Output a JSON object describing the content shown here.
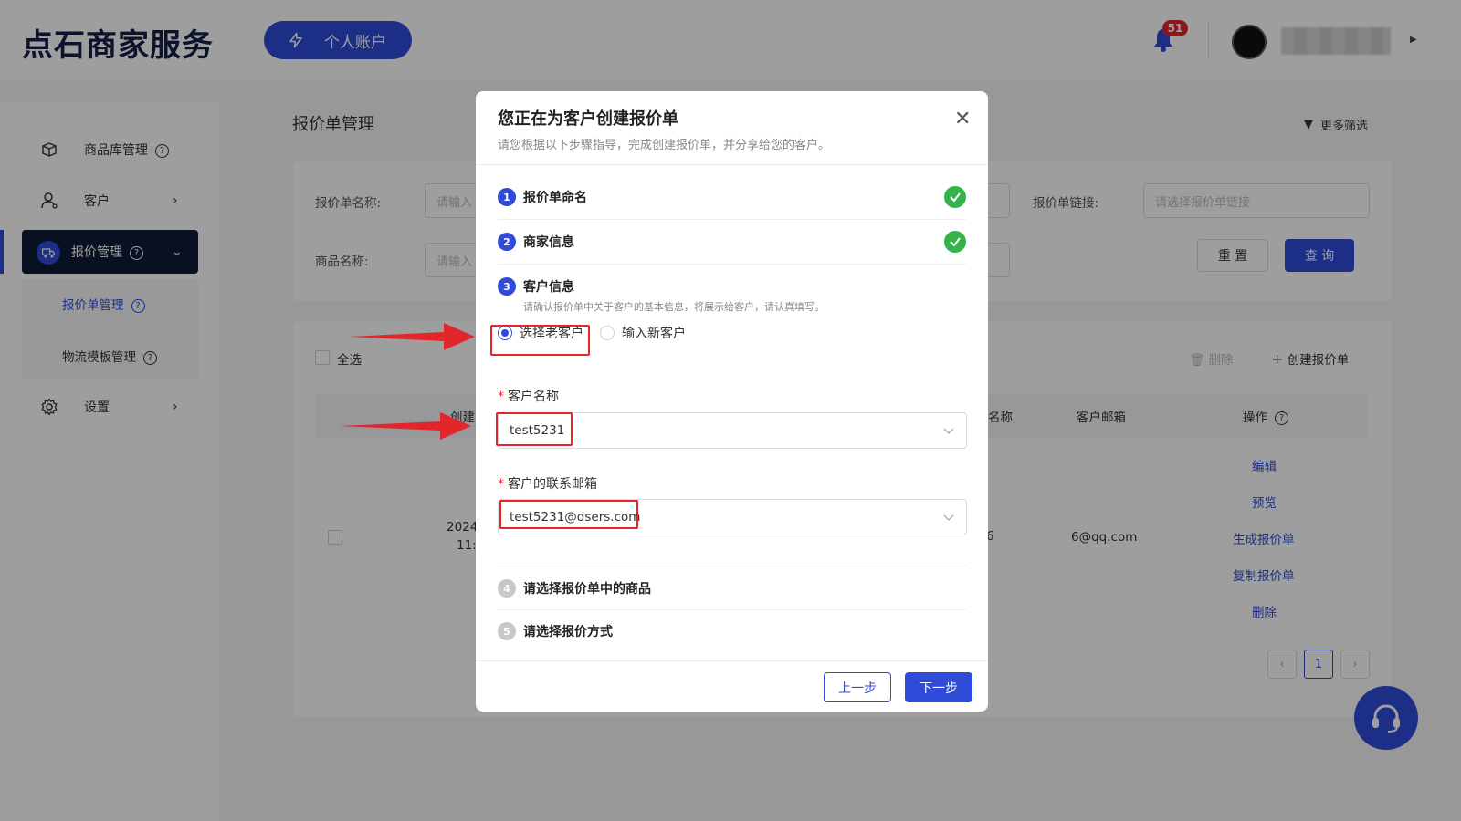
{
  "header": {
    "logo": "点石商家服务",
    "account_button": "个人账户",
    "notification_count": "51"
  },
  "sidebar": {
    "items": [
      {
        "label": "商品库管理"
      },
      {
        "label": "客户"
      },
      {
        "label": "报价管理"
      },
      {
        "label": "设置"
      }
    ],
    "sub_items": [
      {
        "label": "报价单管理"
      },
      {
        "label": "物流模板管理"
      }
    ]
  },
  "main": {
    "title": "报价单管理",
    "more_filter": "更多筛选",
    "filters": {
      "quote_name_label": "报价单名称:",
      "quote_name_placeholder": "请输入",
      "product_name_label": "商品名称:",
      "product_name_placeholder": "请输入",
      "quote_link_label": "报价单链接:",
      "quote_link_placeholder": "请选择报价单链接"
    },
    "reset_button": "重 置",
    "query_button": "查 询",
    "select_all": "全选",
    "delete_button": "删除",
    "create_button": "创建报价单",
    "table": {
      "headers": {
        "created": "创建",
        "name": "名称",
        "email": "客户邮箱",
        "actions": "操作"
      },
      "row": {
        "date": "2024",
        "time": "11:",
        "name_frag": "6",
        "email": "6@qq.com"
      },
      "actions": [
        "编辑",
        "预览",
        "生成报价单",
        "复制报价单",
        "删除"
      ]
    },
    "pagination": {
      "current": "1"
    }
  },
  "modal": {
    "title": "您正在为客户创建报价单",
    "subtitle": "请您根据以下步骤指导，完成创建报价单，并分享给您的客户。",
    "steps": [
      {
        "num": "1",
        "label": "报价单命名",
        "done": true
      },
      {
        "num": "2",
        "label": "商家信息",
        "done": true
      },
      {
        "num": "3",
        "label": "客户信息",
        "done": false
      },
      {
        "num": "4",
        "label": "请选择报价单中的商品",
        "done": false
      },
      {
        "num": "5",
        "label": "请选择报价方式",
        "done": false
      }
    ],
    "customer_hint": "请确认报价单中关于客户的基本信息，将展示给客户，请认真填写。",
    "radio_existing": "选择老客户",
    "radio_new": "输入新客户",
    "customer_name_label": "客户名称",
    "customer_name_value": "test5231",
    "customer_email_label": "客户的联系邮箱",
    "customer_email_value": "test5231@dsers.com",
    "prev_button": "上一步",
    "next_button": "下一步"
  },
  "colors": {
    "primary": "#2f4bd8",
    "sidebar_active": "#0f1b36",
    "success": "#34b34a",
    "highlight": "#e3262c"
  }
}
